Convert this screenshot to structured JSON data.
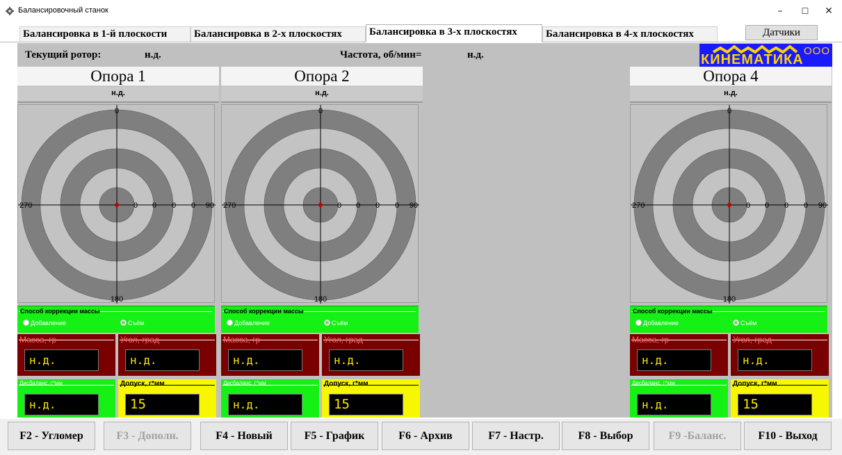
{
  "window": {
    "title": "Балансировочный станок",
    "minimize": "–",
    "maximize": "☐",
    "close": "✕"
  },
  "tabs": [
    {
      "label": "Балансировка в 1-й плоскости",
      "active": false
    },
    {
      "label": "Балансировка в 2-х плоскостях",
      "active": false
    },
    {
      "label": "Балансировка в 3-х плоскостях",
      "active": true
    },
    {
      "label": "Балансировка в 4-х плоскостях",
      "active": false
    }
  ],
  "sensors_button": "Датчики",
  "info": {
    "rotor_label": "Текущий ротор:",
    "rotor_value": "н.д.",
    "freq_label": "Частота, об/мин=",
    "freq_value": "н.д."
  },
  "logo": {
    "text": "КИНЕМАТИКА",
    "ooo": "ООО"
  },
  "target_labels": {
    "top": "0",
    "right": "90",
    "bottom": "180",
    "left": "270",
    "ring": "0"
  },
  "supports": [
    {
      "title": "Опора 1",
      "status": "н.д.",
      "correction_title": "Способ коррекции массы",
      "option_add": "Добавление",
      "option_remove": "Съём",
      "mass_label": "Масса, гр",
      "mass_value": "н.д.",
      "angle_label": "Угол, град",
      "angle_value": "н.д.",
      "imbalance_label": "Дисбаланс, г*мм",
      "imbalance_value": "н.д.",
      "tolerance_label": "Допуск, г*мм",
      "tolerance_value": "15"
    },
    {
      "title": "Опора 2",
      "status": "н.д.",
      "correction_title": "Способ коррекции массы",
      "option_add": "Добавление",
      "option_remove": "Съём",
      "mass_label": "Масса, гр",
      "mass_value": "н.д.",
      "angle_label": "Угол, град",
      "angle_value": "н.д.",
      "imbalance_label": "Дисбаланс, г*мм",
      "imbalance_value": "н.д.",
      "tolerance_label": "Допуск, г*мм",
      "tolerance_value": "15"
    },
    {
      "title": "Опора 4",
      "status": "н.д.",
      "correction_title": "Способ коррекции массы",
      "option_add": "Добавление",
      "option_remove": "Съём",
      "mass_label": "Масса, гр",
      "mass_value": "н.д.",
      "angle_label": "Угол, град",
      "angle_value": "н.д.",
      "imbalance_label": "Дисбаланс, г*мм",
      "imbalance_value": "н.д.",
      "tolerance_label": "Допуск, г*мм",
      "tolerance_value": "15"
    }
  ],
  "fkeys": [
    {
      "label": "F2 - Угломер",
      "enabled": true
    },
    {
      "label": "F3 - Дополн.",
      "enabled": false
    },
    {
      "label": "F4 - Новый",
      "enabled": true
    },
    {
      "label": "F5 - График",
      "enabled": true
    },
    {
      "label": "F6 - Архив",
      "enabled": true
    },
    {
      "label": "F7 - Настр.",
      "enabled": true
    },
    {
      "label": "F8 - Выбор",
      "enabled": true
    },
    {
      "label": "F9 -Баланс.",
      "enabled": false
    },
    {
      "label": "F10 - Выход",
      "enabled": true
    }
  ],
  "colors": {
    "ring_dark": "#7f7f7f",
    "ring_light": "#c3c3c3",
    "correction_green": "#15f015",
    "field_red": "#7a0000",
    "field_yellow": "#f7f700",
    "value_yellow": "#ffea00",
    "logo_blue": "#1a1aff"
  }
}
